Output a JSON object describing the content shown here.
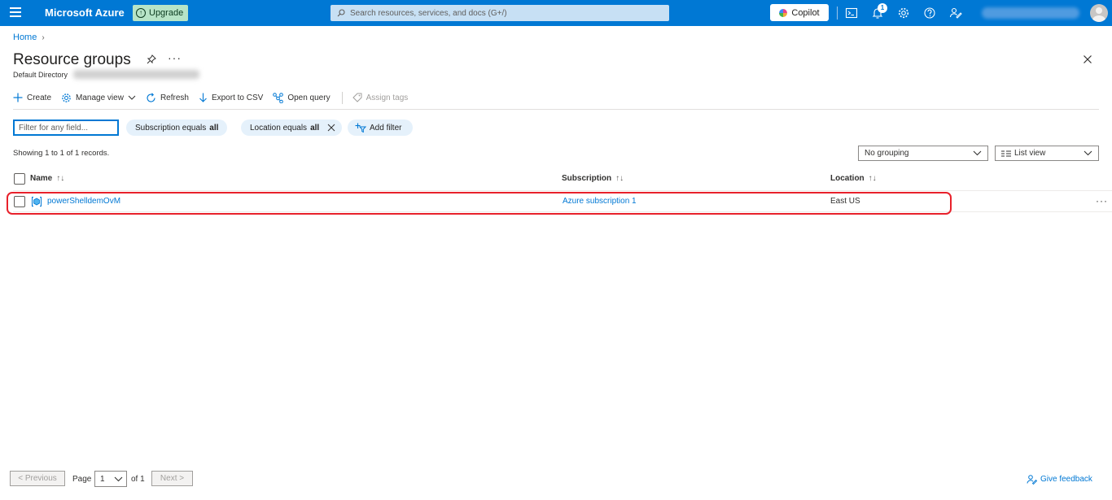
{
  "topbar": {
    "brand": "Microsoft Azure",
    "upgrade_label": "Upgrade",
    "search_placeholder": "Search resources, services, and docs (G+/)",
    "copilot_label": "Copilot",
    "notification_count": "1",
    "icons": [
      "hamburger-icon",
      "cloud-shell-icon",
      "bell-icon",
      "gear-icon",
      "help-icon",
      "feedback-icon"
    ],
    "color": "#0078d4"
  },
  "breadcrumb": {
    "home": "Home"
  },
  "page": {
    "title": "Resource groups",
    "subtitle": "Default Directory",
    "more": "···"
  },
  "toolbar": {
    "create": "Create",
    "manage_view": "Manage view",
    "refresh": "Refresh",
    "export": "Export to CSV",
    "open_query": "Open query",
    "assign_tags": "Assign tags"
  },
  "filters": {
    "placeholder": "Filter for any field...",
    "subscription": {
      "label": "Subscription equals",
      "value": "all"
    },
    "location": {
      "label": "Location equals",
      "value": "all"
    },
    "add_filter": "Add filter"
  },
  "records_text": "Showing 1 to 1 of 1 records.",
  "grouping": "No grouping",
  "view": "List view",
  "table": {
    "columns": [
      "Name",
      "Subscription",
      "Location"
    ],
    "rows": [
      {
        "name": "powerShelldemOvM",
        "subscription": "Azure subscription 1",
        "location": "East US"
      }
    ],
    "sort_glyph": "↑↓",
    "row_more": "···"
  },
  "pager": {
    "previous": "< Previous",
    "page_label": "Page",
    "page_value": "1",
    "of_label": "of 1",
    "next": "Next >"
  },
  "feedback": "Give feedback",
  "highlight_color": "#e8212b"
}
